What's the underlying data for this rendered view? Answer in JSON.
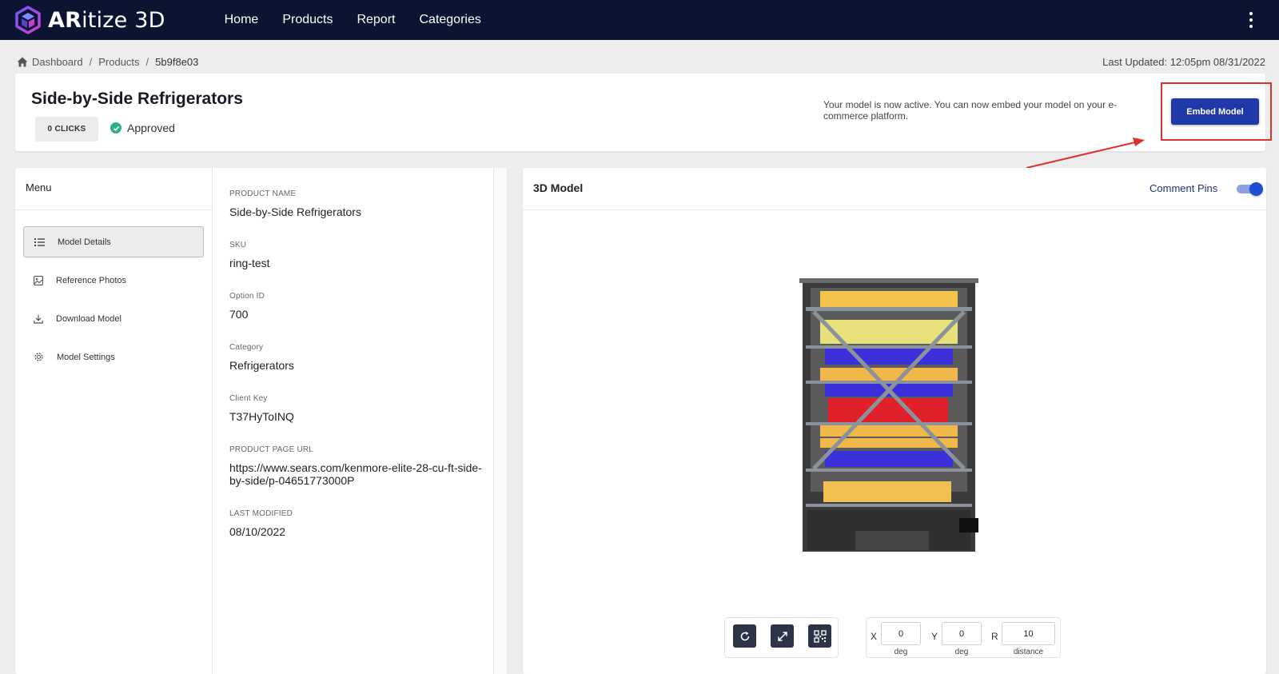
{
  "app": {
    "brand_bold": "AR",
    "brand_rest": "itize 3D"
  },
  "nav": {
    "links": [
      "Home",
      "Products",
      "Report",
      "Categories"
    ]
  },
  "breadcrumb": {
    "items": [
      "Dashboard",
      "Products",
      "5b9f8e03"
    ]
  },
  "last_updated": "Last Updated: 12:05pm 08/31/2022",
  "header": {
    "title": "Side-by-Side Refrigerators",
    "clicks": "0 CLICKS",
    "status": "Approved",
    "message": "Your model is now active. You can now embed your model on your e-commerce platform.",
    "embed_label": "Embed Model"
  },
  "menu": {
    "title": "Menu",
    "items": [
      "Model Details",
      "Reference Photos",
      "Download Model",
      "Model Settings"
    ]
  },
  "details": {
    "product_name_label": "PRODUCT NAME",
    "product_name": "Side-by-Side Refrigerators",
    "sku_label": "SKU",
    "sku": "ring-test",
    "option_id_label": "Option ID",
    "option_id": "700",
    "category_label": "Category",
    "category": "Refrigerators",
    "client_key_label": "Client Key",
    "client_key": "T37HyToINQ",
    "url_label": "PRODUCT PAGE URL",
    "url": "https://www.sears.com/kenmore-elite-28-cu-ft-side-by-side/p-04651773000P",
    "last_modified_label": "LAST MODIFIED",
    "last_modified": "08/10/2022"
  },
  "model": {
    "title": "3D Model",
    "pins_label": "Comment Pins",
    "pins_enabled": true
  },
  "controls": {
    "x_label": "X",
    "x_value": "0",
    "x_unit": "deg",
    "y_label": "Y",
    "y_value": "0",
    "y_unit": "deg",
    "r_label": "R",
    "r_value": "10",
    "r_unit": "distance"
  },
  "colors": {
    "navbar": "#0b1430",
    "primary_button": "#1f3aa8",
    "highlight": "#d8332d",
    "approved": "#2fb37a"
  },
  "icons": {
    "nav": [
      "logo-cube-icon",
      "kebab-menu-icon"
    ],
    "breadcrumb": [
      "home-icon"
    ],
    "menu": [
      "list-icon",
      "image-icon",
      "download-icon",
      "gear-icon"
    ],
    "controls": [
      "rotate-icon",
      "expand-icon",
      "qr-code-icon"
    ],
    "status": "check-circle-icon"
  }
}
